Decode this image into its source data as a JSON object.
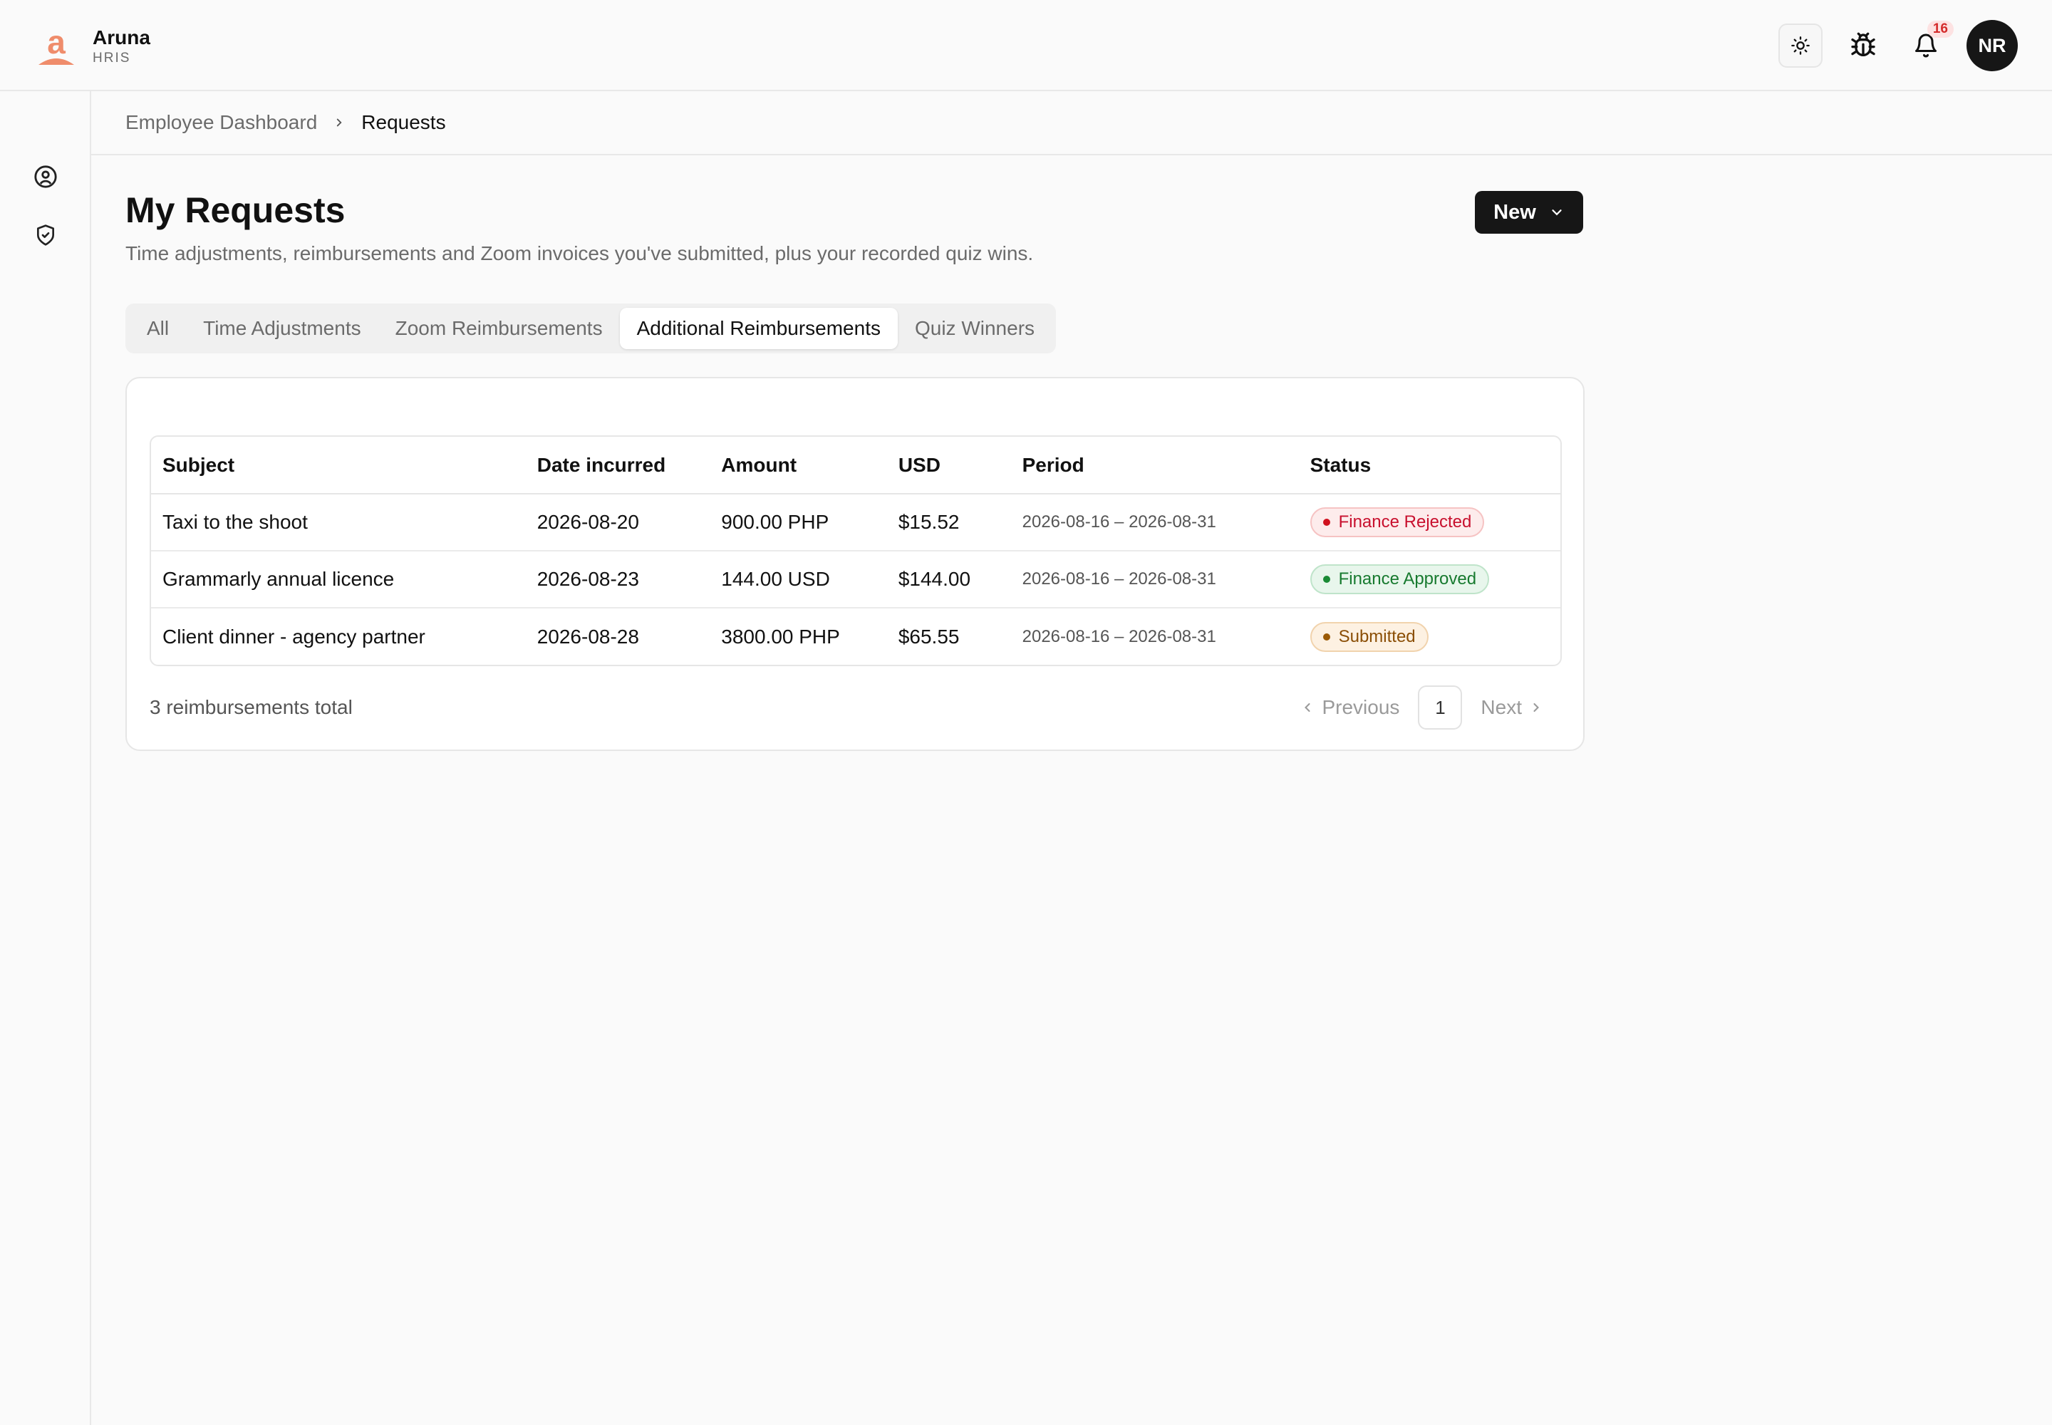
{
  "brand": {
    "name": "Aruna",
    "sub": "HRIS",
    "logo_color": "#ef8c6b"
  },
  "header": {
    "notification_count": "16",
    "avatar_initials": "NR",
    "icons": [
      "sun-icon",
      "bug-icon",
      "bell-icon"
    ]
  },
  "sidebar": {
    "items": [
      {
        "icon": "user-circle-icon"
      },
      {
        "icon": "shield-check-icon"
      }
    ]
  },
  "breadcrumb": {
    "parent": "Employee Dashboard",
    "current": "Requests"
  },
  "page": {
    "title": "My Requests",
    "description": "Time adjustments, reimbursements and Zoom invoices you've submitted, plus your recorded quiz wins.",
    "new_button": "New"
  },
  "tabs": [
    {
      "label": "All",
      "active": false
    },
    {
      "label": "Time Adjustments",
      "active": false
    },
    {
      "label": "Zoom Reimbursements",
      "active": false
    },
    {
      "label": "Additional Reimbursements",
      "active": true
    },
    {
      "label": "Quiz Winners",
      "active": false
    }
  ],
  "table": {
    "columns": [
      "Subject",
      "Date incurred",
      "Amount",
      "USD",
      "Period",
      "Status"
    ],
    "rows": [
      {
        "subject": "Taxi to the shoot",
        "date": "2026-08-20",
        "amount": "900.00 PHP",
        "usd": "$15.52",
        "period": "2026-08-16 – 2026-08-31",
        "status": "Finance Rejected",
        "status_color": "#c8102e"
      },
      {
        "subject": "Grammarly annual licence",
        "date": "2026-08-23",
        "amount": "144.00 USD",
        "usd": "$144.00",
        "period": "2026-08-16 – 2026-08-31",
        "status": "Finance Approved",
        "status_color": "#177a2f"
      },
      {
        "subject": "Client dinner - agency partner",
        "date": "2026-08-28",
        "amount": "3800.00 PHP",
        "usd": "$65.55",
        "period": "2026-08-16 – 2026-08-31",
        "status": "Submitted",
        "status_color": "#8a4e05"
      }
    ]
  },
  "footer": {
    "total": "3 reimbursements total",
    "prev": "Previous",
    "page": "1",
    "next": "Next"
  }
}
